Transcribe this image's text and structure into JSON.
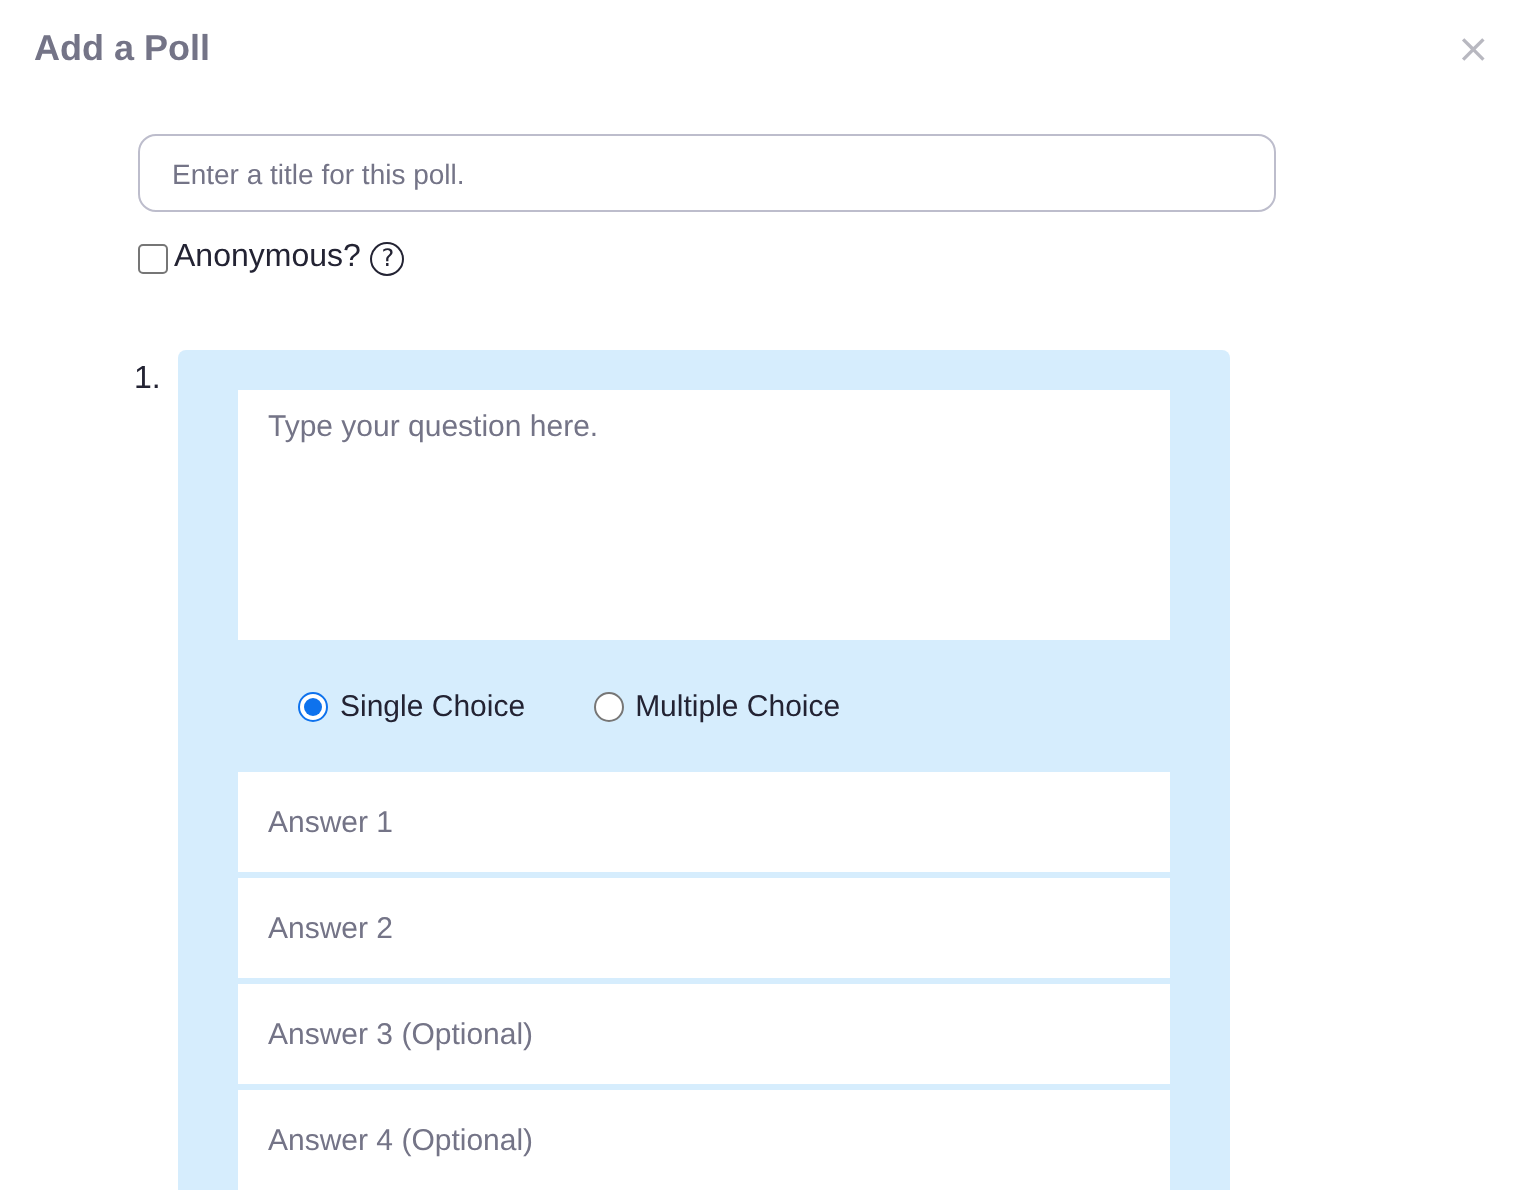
{
  "dialog": {
    "title": "Add a Poll",
    "close": "×"
  },
  "poll_title": {
    "placeholder": "Enter a title for this poll."
  },
  "anonymous": {
    "label": "Anonymous?",
    "checked": false,
    "help": "?"
  },
  "questions": [
    {
      "number": "1.",
      "placeholder": "Type your question here.",
      "choice_types": [
        {
          "label": "Single Choice",
          "selected": true
        },
        {
          "label": "Multiple Choice",
          "selected": false
        }
      ],
      "answers": [
        {
          "placeholder": "Answer 1"
        },
        {
          "placeholder": "Answer 2"
        },
        {
          "placeholder": "Answer 3 (Optional)"
        },
        {
          "placeholder": "Answer 4 (Optional)"
        }
      ]
    }
  ]
}
